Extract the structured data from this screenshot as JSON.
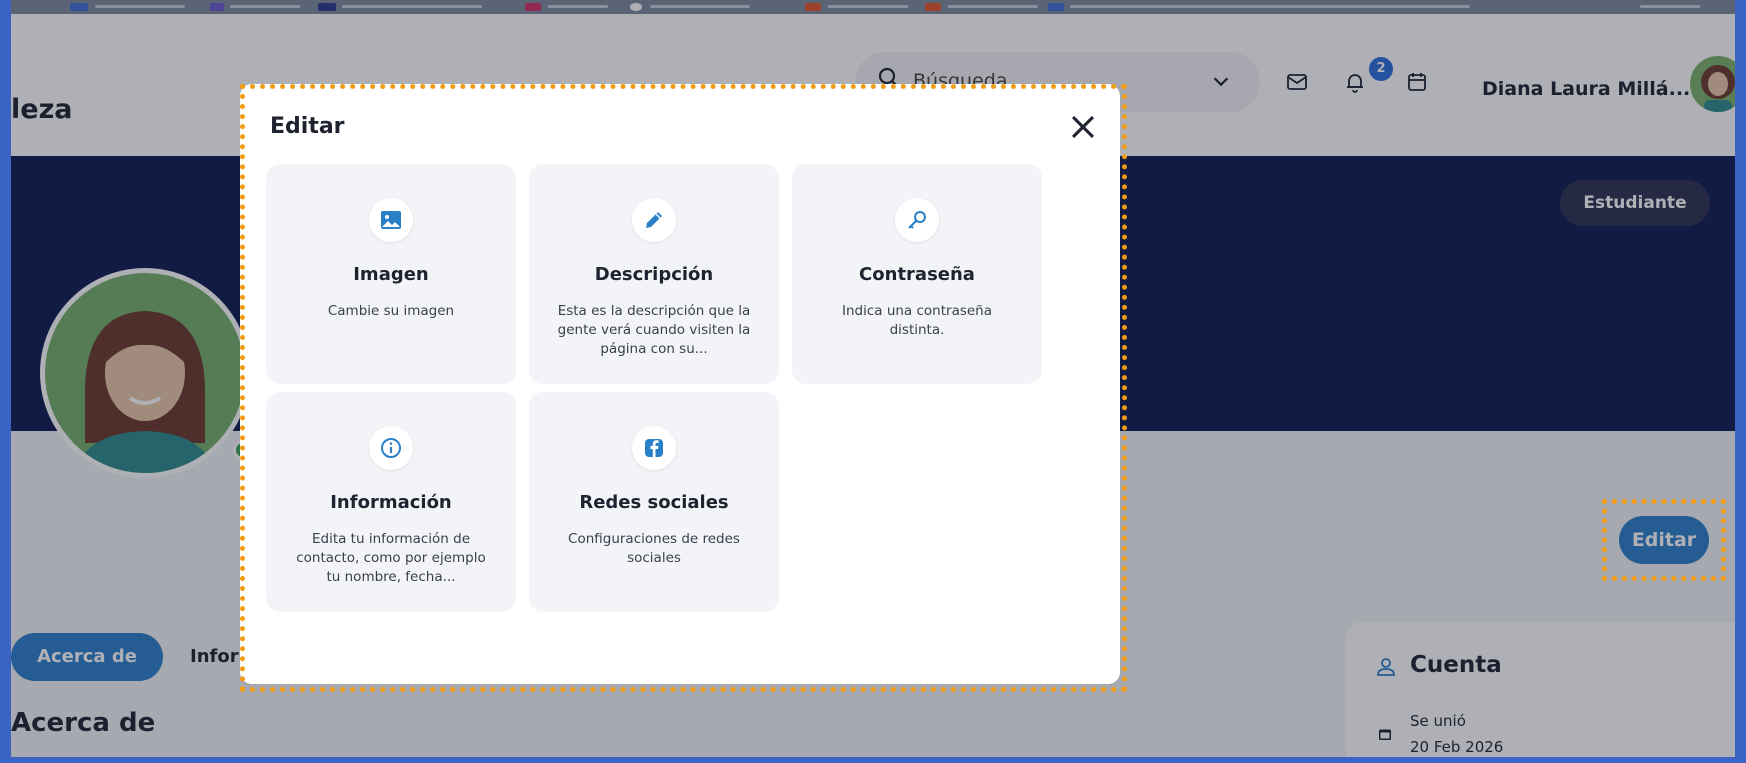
{
  "header": {
    "brand_partial": "leza",
    "search_placeholder": "Búsqueda",
    "notifications_count": "2",
    "user_name": "Diana Laura Millá..."
  },
  "profile": {
    "role_badge": "Estudiante",
    "edit_button": "Editar"
  },
  "tabs": {
    "about": "Acerca de",
    "info_partial": "Infor"
  },
  "about_heading": "Acerca de",
  "account": {
    "title": "Cuenta",
    "joined_label": "Se unió",
    "joined_date": "20 Feb 2026"
  },
  "modal": {
    "title": "Editar",
    "options": [
      {
        "icon": "image-icon",
        "title": "Imagen",
        "description": "Cambie su imagen"
      },
      {
        "icon": "pencil-icon",
        "title": "Descripción",
        "description": "Esta es la descripción que la gente verá cuando visiten la página con su..."
      },
      {
        "icon": "key-icon",
        "title": "Contraseña",
        "description": "Indica una contraseña distinta."
      },
      {
        "icon": "info-icon",
        "title": "Información",
        "description": "Edita tu información de contacto, como por ejemplo tu nombre, fecha..."
      },
      {
        "icon": "facebook-icon",
        "title": "Redes sociales",
        "description": "Configuraciones de redes sociales"
      }
    ]
  },
  "colors": {
    "accent": "#2a7fc9",
    "banner": "#0d1b4f",
    "highlight": "#f39c12",
    "frame": "#3b63c4"
  }
}
